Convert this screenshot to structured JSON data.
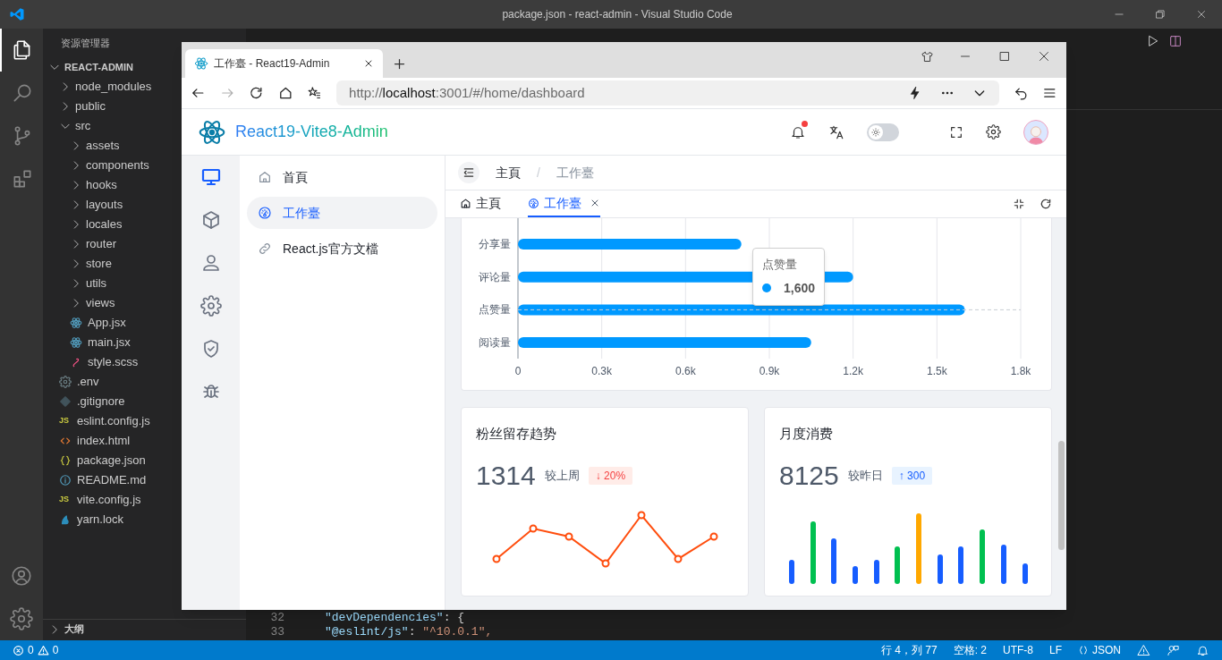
{
  "vscode": {
    "title": "package.json - react-admin - Visual Studio Code",
    "activity_bar": [
      {
        "kind": "files",
        "selected": true
      },
      {
        "kind": "search",
        "selected": false
      },
      {
        "kind": "scm",
        "selected": false
      },
      {
        "kind": "extensions",
        "selected": false
      }
    ],
    "activity_bottom": [
      {
        "kind": "account"
      },
      {
        "kind": "gear"
      }
    ],
    "explorer": {
      "title": "资源管理器",
      "root": {
        "label": "REACT-ADMIN",
        "kind": "folder",
        "expanded": true,
        "children": [
          {
            "label": "node_modules",
            "kind": "folder",
            "expanded": false
          },
          {
            "label": "public",
            "kind": "folder",
            "expanded": false
          },
          {
            "label": "src",
            "kind": "folder",
            "expanded": true,
            "children": [
              {
                "label": "assets",
                "kind": "folder",
                "expanded": false
              },
              {
                "label": "components",
                "kind": "folder",
                "expanded": false
              },
              {
                "label": "hooks",
                "kind": "folder",
                "expanded": false
              },
              {
                "label": "layouts",
                "kind": "folder",
                "expanded": false
              },
              {
                "label": "locales",
                "kind": "folder",
                "expanded": false
              },
              {
                "label": "router",
                "kind": "folder",
                "expanded": false
              },
              {
                "label": "store",
                "kind": "folder",
                "expanded": false
              },
              {
                "label": "utils",
                "kind": "folder",
                "expanded": false
              },
              {
                "label": "views",
                "kind": "folder",
                "expanded": false
              },
              {
                "label": "App.jsx",
                "kind": "react"
              },
              {
                "label": "main.jsx",
                "kind": "react"
              },
              {
                "label": "style.scss",
                "kind": "sass"
              }
            ]
          },
          {
            "label": ".env",
            "kind": "env"
          },
          {
            "label": ".gitignore",
            "kind": "git"
          },
          {
            "label": "eslint.config.js",
            "kind": "js",
            "icon_text": "JS"
          },
          {
            "label": "index.html",
            "kind": "html"
          },
          {
            "label": "package.json",
            "kind": "json"
          },
          {
            "label": "README.md",
            "kind": "info"
          },
          {
            "label": "vite.config.js",
            "kind": "js",
            "icon_text": "JS"
          },
          {
            "label": "yarn.lock",
            "kind": "yarn"
          }
        ]
      },
      "outline": {
        "label": "大纲",
        "expanded": false
      }
    },
    "editor": {
      "lines": [
        {
          "number": "32",
          "key": "\"devDependencies\"",
          "rest": ": {"
        },
        {
          "number": "33",
          "key": "\"@eslint/js\"",
          "rest": ": ",
          "value": "\"^10.0.1\","
        }
      ]
    },
    "status_bar": {
      "errors": "0",
      "warnings": "0",
      "items": [
        {
          "kind": "text",
          "text": "行 4，列 77"
        },
        {
          "kind": "text",
          "text": "空格: 2"
        },
        {
          "kind": "text",
          "text": "UTF-8"
        },
        {
          "kind": "text",
          "text": "LF"
        },
        {
          "kind": "json",
          "text": "JSON"
        }
      ]
    }
  },
  "browser": {
    "tab": {
      "title": "工作臺 - React19-Admin"
    },
    "nav_buttons": [
      {
        "kind": "back",
        "disabled": false
      },
      {
        "kind": "forward",
        "disabled": true
      },
      {
        "kind": "reload",
        "disabled": false
      },
      {
        "kind": "home",
        "disabled": false
      }
    ],
    "url": {
      "value": "http://**localhost**:3001/#/home/dashboard"
    },
    "app": {
      "title": "React19-Vite8-Admin",
      "has_notification": true,
      "dark_mode": false,
      "rail": [
        {
          "kind": "monitor",
          "selected": true
        },
        {
          "kind": "cube",
          "selected": false
        },
        {
          "kind": "user",
          "selected": false
        },
        {
          "kind": "gear",
          "selected": false
        },
        {
          "kind": "shield",
          "selected": false
        },
        {
          "kind": "bug",
          "selected": false
        }
      ],
      "menu": [
        {
          "label": "首頁",
          "kind": "home",
          "selected": false
        },
        {
          "label": "工作臺",
          "kind": "dashboard",
          "selected": true
        },
        {
          "label": "React.js官方文檔",
          "kind": "link",
          "selected": false
        }
      ],
      "breadcrumb_separator": "/",
      "breadcrumb": [
        {
          "label": "主頁",
          "current": false
        },
        {
          "label": "工作臺",
          "current": true
        }
      ],
      "page_tabs": [
        {
          "label": "主頁",
          "kind": "home",
          "selected": false,
          "closable": false
        },
        {
          "label": "工作臺",
          "kind": "dashboard",
          "selected": true,
          "closable": true
        }
      ],
      "chart": {
        "chart_data": {
          "type": "bar",
          "orientation": "horizontal",
          "categories": [
            "分享量",
            "评论量",
            "点赞量",
            "阅读量"
          ],
          "series": [
            {
              "color": "#0099ff",
              "values": [
                800,
                1200,
                1600,
                1050
              ]
            }
          ],
          "grid": true,
          "xlim": [
            0,
            1800
          ],
          "xticks": [
            {
              "value": 0,
              "label": "0"
            },
            {
              "value": 300,
              "label": "0.3k"
            },
            {
              "value": 600,
              "label": "0.6k"
            },
            {
              "value": 900,
              "label": "0.9k"
            },
            {
              "value": 1200,
              "label": "1.2k"
            },
            {
              "value": 1500,
              "label": "1.5k"
            },
            {
              "value": 1800,
              "label": "1.8k"
            }
          ]
        },
        "tooltip": {
          "title": "点赞量",
          "value": "1,600"
        }
      },
      "stats": [
        {
          "title": "粉丝留存趋势",
          "value": "1314",
          "compare": "较上周",
          "change": "↓ 20%",
          "positive": false,
          "kind": "line"
        },
        {
          "title": "月度消费",
          "value": "8125",
          "compare": "较昨日",
          "change": "↑ 300",
          "positive": true,
          "kind": "bars"
        }
      ]
    }
  }
}
